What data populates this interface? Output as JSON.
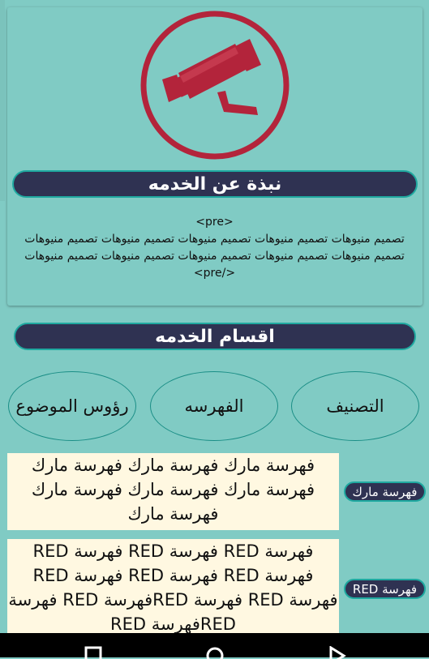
{
  "about": {
    "title": "نبذة عن الخدمه",
    "pre_open": "<pre>",
    "body": "تصميم منيوهات تصميم منيوهات تصميم منيوهات تصميم منيوهات تصميم منيوهات تصميم منيوهات تصميم منيوهات تصميم منيوهات تصميم منيوهات تصميم منيوهات </pre>"
  },
  "sections": {
    "title": "اقسام الخدمه",
    "buttons": [
      {
        "label": "التصنيف"
      },
      {
        "label": "الفهرسه"
      },
      {
        "label": "رؤوس الموضوع"
      }
    ]
  },
  "entries": [
    {
      "text": "فهرسة مارك فهرسة مارك فهرسة مارك فهرسة مارك فهرسة مارك فهرسة مارك فهرسة مارك",
      "tag": "فهرسة مارك"
    },
    {
      "text": "فهرسة RED فهرسة RED فهرسة RED فهرسة RED فهرسة RED فهرسة RED فهرسة RED فهرسة REDفهرسة RED فهرسة REDفهرسة RED",
      "tag": "فهرسة RED"
    }
  ],
  "icons": {
    "logo": "security-camera-icon",
    "back": "back-triangle-icon",
    "home": "home-circle-icon",
    "recent": "recent-square-icon"
  },
  "colors": {
    "background": "#80cbc4",
    "header_fill": "#2f3252",
    "logo_red": "#b3243b",
    "entry_bg": "#fff8e1"
  }
}
